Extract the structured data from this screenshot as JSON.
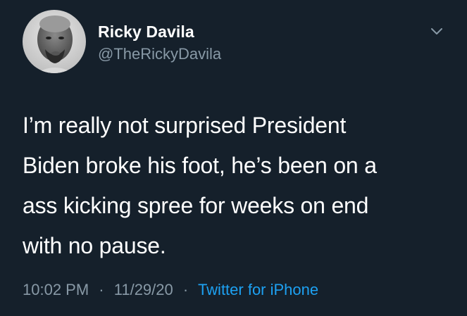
{
  "author": {
    "name": "Ricky Davila",
    "handle": "@TheRickyDavila"
  },
  "tweet": {
    "lines": [
      "I’m really not surprised President",
      "Biden broke his foot, he’s been on a",
      "ass kicking spree for weeks on end",
      "with no pause."
    ]
  },
  "meta": {
    "time": "10:02 PM",
    "separator": "·",
    "date": "11/29/20",
    "source": "Twitter for iPhone"
  },
  "icons": {
    "menu": "chevron-down-icon"
  },
  "colors": {
    "background": "#15202b",
    "text": "#ffffff",
    "secondary": "#8899a6",
    "accent": "#1da1f2"
  }
}
